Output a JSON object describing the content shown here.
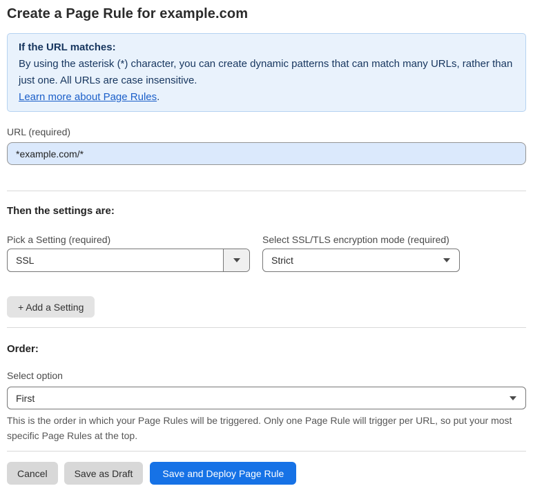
{
  "page": {
    "title": "Create a Page Rule for example.com"
  },
  "info_box": {
    "heading": "If the URL matches:",
    "body": "By using the asterisk (*) character, you can create dynamic patterns that can match many URLs, rather than just one. All URLs are case insensitive.",
    "link_label": "Learn more about Page Rules",
    "link_suffix": "."
  },
  "url_field": {
    "label": "URL (required)",
    "value": "*example.com/*"
  },
  "settings_section": {
    "heading": "Then the settings are:",
    "pick_setting": {
      "label": "Pick a Setting (required)",
      "value": "SSL"
    },
    "encryption_mode": {
      "label": "Select SSL/TLS encryption mode (required)",
      "value": "Strict"
    },
    "add_setting_label": "+ Add a Setting"
  },
  "order_section": {
    "heading": "Order:",
    "select_label": "Select option",
    "value": "First",
    "help_text": "This is the order in which your Page Rules will be triggered. Only one Page Rule will trigger per URL, so put your most specific Page Rules at the top."
  },
  "footer": {
    "cancel_label": "Cancel",
    "save_draft_label": "Save as Draft",
    "save_deploy_label": "Save and Deploy Page Rule"
  },
  "colors": {
    "accent_blue": "#1672e6",
    "info_bg": "#e9f2fc",
    "info_border": "#b5d2f1",
    "info_text": "#16355e",
    "link_blue": "#1b5fc9",
    "input_bg": "#dbe9fc"
  }
}
